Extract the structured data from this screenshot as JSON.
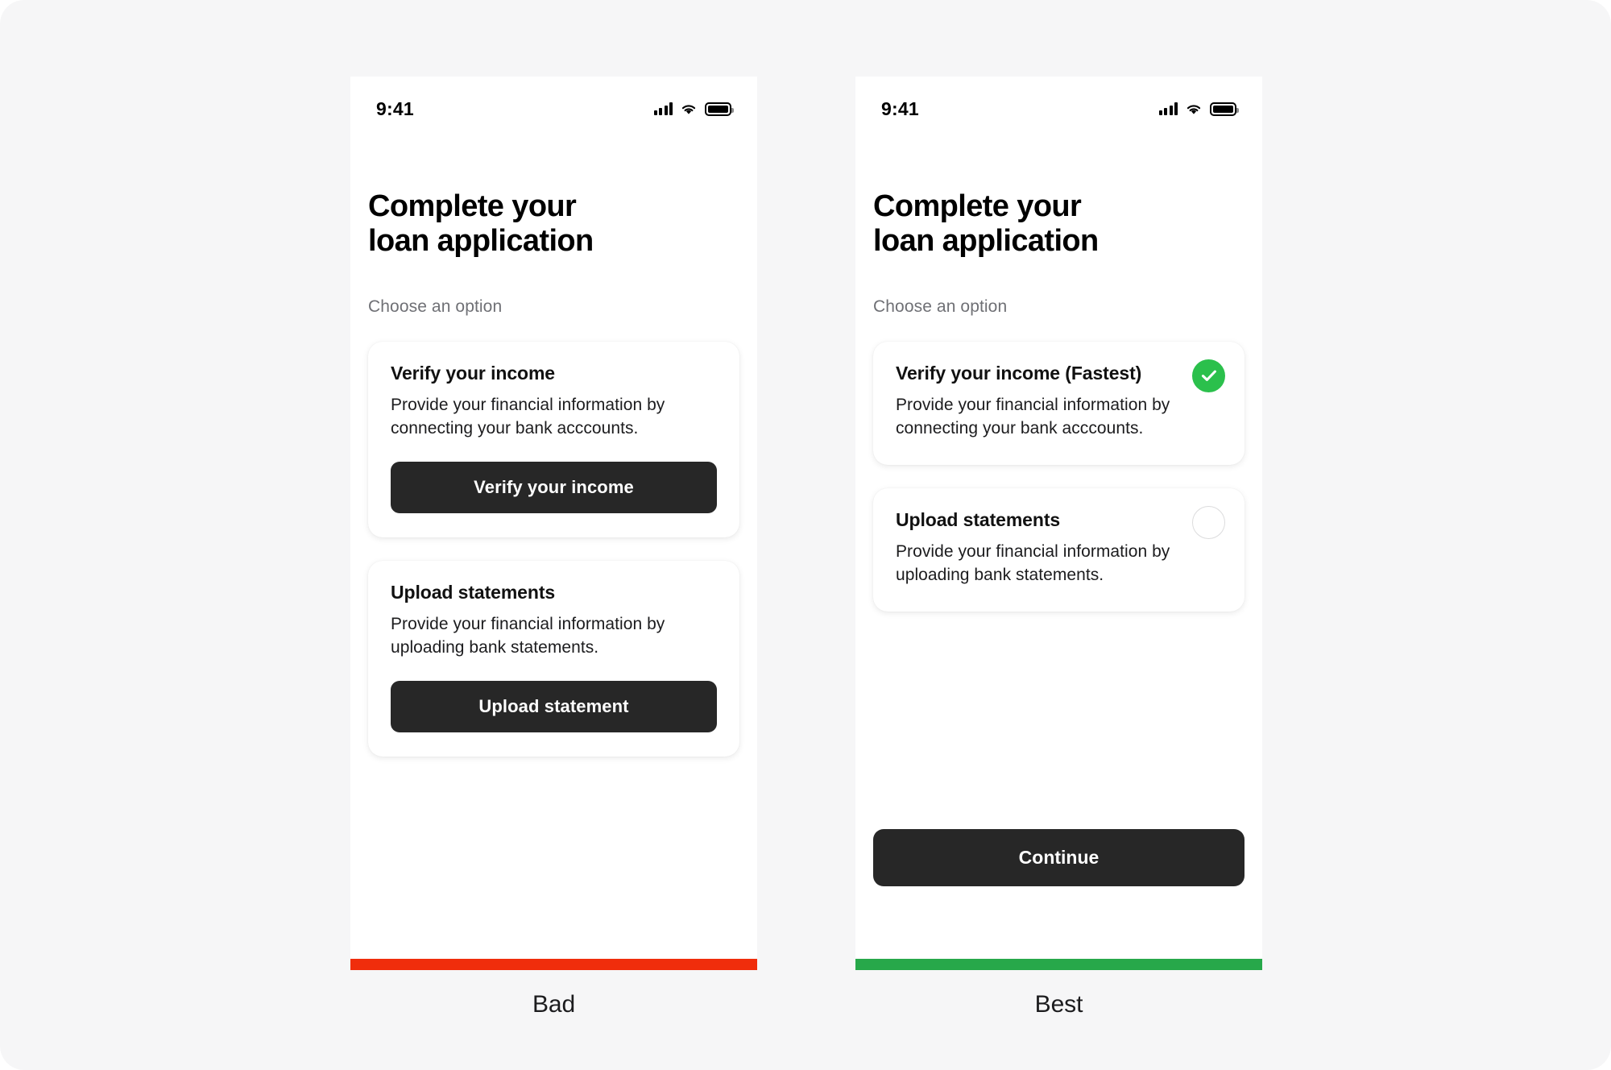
{
  "page": {
    "background_color": "#f6f6f7"
  },
  "panels": [
    {
      "id": "bad",
      "status_bar": {
        "time": "9:41",
        "icons": [
          "cellular-signal-icon",
          "wifi-icon",
          "battery-icon"
        ]
      },
      "headline": "Complete your\nloan application",
      "subhead": "Choose an option",
      "cards": [
        {
          "title": "Verify your income",
          "description": "Provide your financial information by connecting your bank acccounts.",
          "button_label": "Verify your income",
          "indicator": "none"
        },
        {
          "title": "Upload statements",
          "description": "Provide your financial information by uploading bank statements.",
          "button_label": "Upload statement",
          "indicator": "none"
        }
      ],
      "continue_label": null,
      "verdict": {
        "label": "Bad",
        "color": "#f02d0c"
      }
    },
    {
      "id": "best",
      "status_bar": {
        "time": "9:41",
        "icons": [
          "cellular-signal-icon",
          "wifi-icon",
          "battery-icon"
        ]
      },
      "headline": "Complete your\nloan application",
      "subhead": "Choose an option",
      "cards": [
        {
          "title": "Verify your income (Fastest)",
          "description": "Provide your financial information by connecting your bank acccounts.",
          "button_label": null,
          "indicator": "checked"
        },
        {
          "title": "Upload statements",
          "description": "Provide your financial information by uploading bank statements.",
          "button_label": null,
          "indicator": "empty"
        }
      ],
      "continue_label": "Continue",
      "verdict": {
        "label": "Best",
        "color": "#27a84a"
      }
    }
  ],
  "colors": {
    "button_dark": "#272727",
    "check_green": "#2bc04c",
    "bad_red": "#f02d0c",
    "best_green": "#27a84a",
    "muted_text": "#6f7075"
  }
}
